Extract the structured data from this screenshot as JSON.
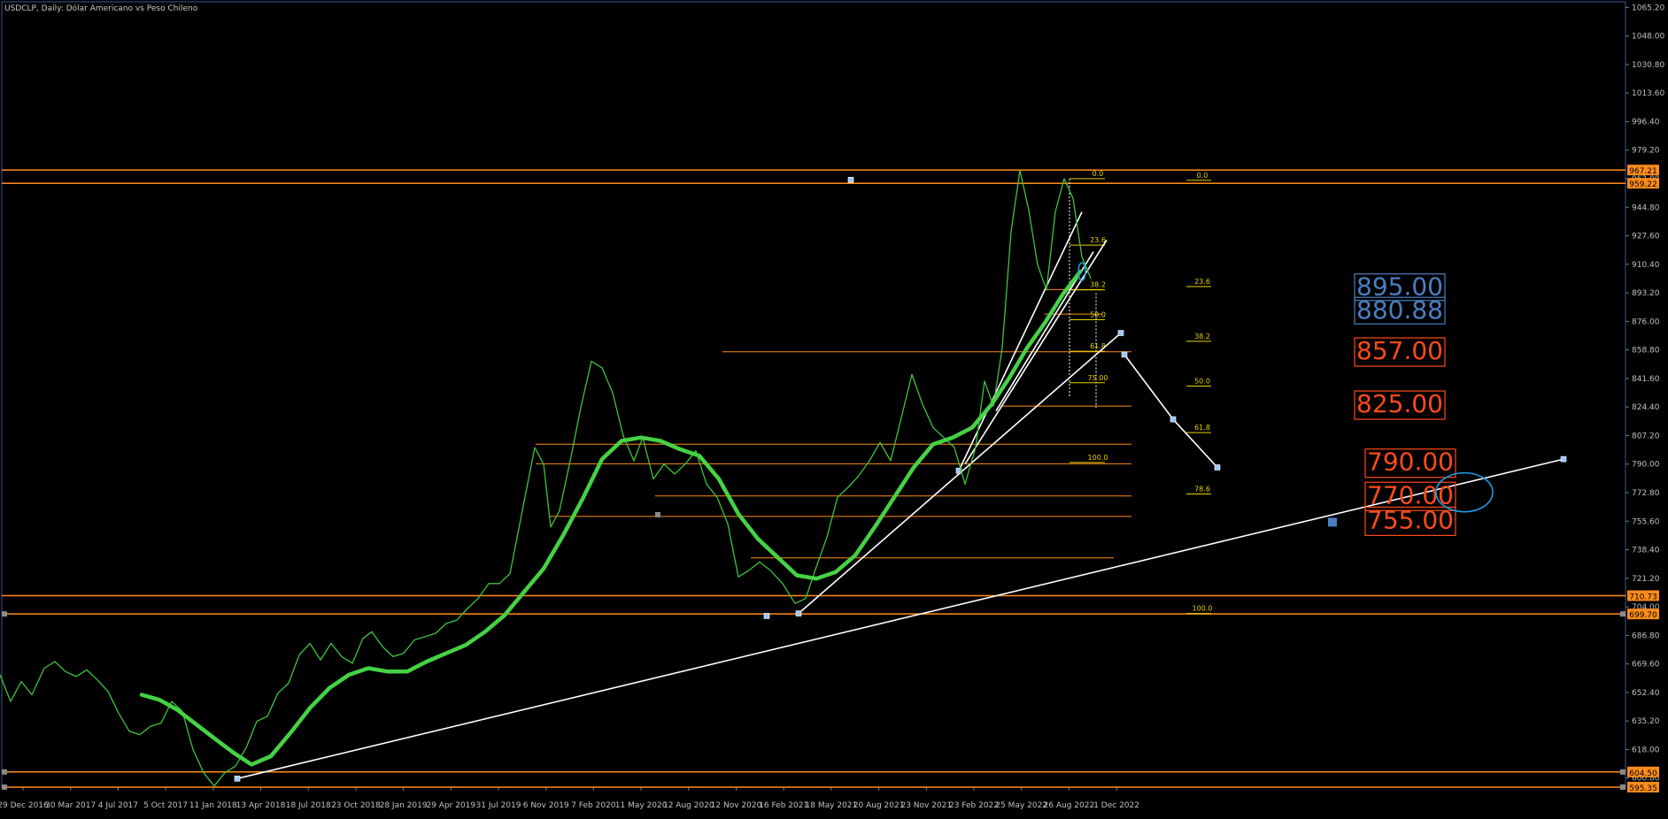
{
  "chart_data": {
    "type": "line",
    "title": "USDCLP, Daily:  Dólar Americano vs Peso Chileno",
    "y_axis_ticks": [
      "1065.20",
      "1048.00",
      "1030.80",
      "1013.60",
      "996.40",
      "979.20",
      "962.00",
      "944.80",
      "927.60",
      "910.40",
      "893.20",
      "876.00",
      "858.80",
      "841.60",
      "824.40",
      "807.20",
      "790.00",
      "772.80",
      "755.60",
      "738.40",
      "721.20",
      "704.00",
      "686.80",
      "669.60",
      "652.40",
      "635.20",
      "618.00",
      "600.80"
    ],
    "x_axis_ticks": [
      "29 Dec 2016",
      "30 Mar 2017",
      "4 Jul 2017",
      "5 Oct 2017",
      "11 Jan 2018",
      "13 Apr 2018",
      "18 Jul 2018",
      "23 Oct 2018",
      "28 Jan 2019",
      "29 Apr 2019",
      "31 Jul 2019",
      "6 Nov 2019",
      "7 Feb 2020",
      "11 May 2020",
      "12 Aug 2020",
      "12 Nov 2020",
      "16 Feb 2021",
      "18 May 2021",
      "20 Aug 2021",
      "23 Nov 2021",
      "23 Feb 2022",
      "25 May 2022",
      "26 Aug 2022",
      "1 Dec 2022"
    ],
    "ylim": [
      590,
      1067
    ],
    "series": [
      {
        "color": "#3cc43c",
        "values": [
          [
            0,
            663
          ],
          [
            12,
            647
          ],
          [
            24,
            659
          ],
          [
            36,
            651
          ],
          [
            50,
            667
          ],
          [
            62,
            671
          ],
          [
            74,
            665
          ],
          [
            86,
            662
          ],
          [
            98,
            666
          ],
          [
            110,
            660
          ],
          [
            122,
            653
          ],
          [
            134,
            640
          ],
          [
            146,
            629
          ],
          [
            158,
            627
          ],
          [
            170,
            632
          ],
          [
            182,
            634
          ],
          [
            194,
            647
          ],
          [
            206,
            641
          ],
          [
            218,
            618
          ],
          [
            230,
            604
          ],
          [
            242,
            596
          ],
          [
            254,
            604
          ],
          [
            266,
            608
          ],
          [
            278,
            619
          ],
          [
            290,
            635
          ],
          [
            302,
            638
          ],
          [
            314,
            652
          ],
          [
            326,
            658
          ],
          [
            338,
            675
          ],
          [
            350,
            682
          ],
          [
            362,
            672
          ],
          [
            374,
            682
          ],
          [
            386,
            674
          ],
          [
            398,
            670
          ],
          [
            410,
            685
          ],
          [
            420,
            689
          ],
          [
            432,
            680
          ],
          [
            444,
            674
          ],
          [
            456,
            676
          ],
          [
            468,
            684
          ],
          [
            480,
            686
          ],
          [
            492,
            688
          ],
          [
            504,
            694
          ],
          [
            516,
            696
          ],
          [
            528,
            703
          ],
          [
            540,
            709
          ],
          [
            552,
            718
          ],
          [
            564,
            718
          ],
          [
            576,
            724
          ],
          [
            590,
            762
          ],
          [
            604,
            800
          ],
          [
            614,
            790
          ],
          [
            622,
            752
          ],
          [
            632,
            762
          ],
          [
            644,
            792
          ],
          [
            656,
            824
          ],
          [
            668,
            852
          ],
          [
            680,
            848
          ],
          [
            692,
            833
          ],
          [
            704,
            807
          ],
          [
            716,
            792
          ],
          [
            726,
            806
          ],
          [
            738,
            781
          ],
          [
            750,
            790
          ],
          [
            762,
            784
          ],
          [
            774,
            790
          ],
          [
            786,
            798
          ],
          [
            798,
            778
          ],
          [
            810,
            770
          ],
          [
            822,
            754
          ],
          [
            834,
            722
          ],
          [
            846,
            726
          ],
          [
            858,
            731
          ],
          [
            870,
            726
          ],
          [
            884,
            718
          ],
          [
            898,
            706
          ],
          [
            910,
            709
          ],
          [
            922,
            728
          ],
          [
            934,
            746
          ],
          [
            946,
            770
          ],
          [
            958,
            776
          ],
          [
            970,
            783
          ],
          [
            982,
            792
          ],
          [
            994,
            803
          ],
          [
            1006,
            792
          ],
          [
            1018,
            818
          ],
          [
            1030,
            844
          ],
          [
            1042,
            826
          ],
          [
            1054,
            812
          ],
          [
            1066,
            806
          ],
          [
            1078,
            800
          ],
          [
            1090,
            778
          ],
          [
            1102,
            800
          ],
          [
            1112,
            840
          ],
          [
            1122,
            825
          ],
          [
            1132,
            860
          ],
          [
            1142,
            930
          ],
          [
            1152,
            967
          ],
          [
            1162,
            943
          ],
          [
            1172,
            910
          ],
          [
            1182,
            895
          ],
          [
            1192,
            942
          ],
          [
            1202,
            962
          ],
          [
            1212,
            950
          ],
          [
            1222,
            915
          ],
          [
            1232,
            902
          ]
        ]
      },
      {
        "color": "#45d245",
        "values": [
          [
            160,
            651
          ],
          [
            180,
            648
          ],
          [
            200,
            642
          ],
          [
            222,
            633
          ],
          [
            244,
            624
          ],
          [
            264,
            616
          ],
          [
            284,
            609
          ],
          [
            306,
            614
          ],
          [
            328,
            628
          ],
          [
            350,
            643
          ],
          [
            372,
            655
          ],
          [
            394,
            663
          ],
          [
            416,
            667
          ],
          [
            438,
            665
          ],
          [
            460,
            665
          ],
          [
            482,
            671
          ],
          [
            504,
            676
          ],
          [
            526,
            681
          ],
          [
            548,
            689
          ],
          [
            570,
            699
          ],
          [
            592,
            713
          ],
          [
            614,
            727
          ],
          [
            636,
            747
          ],
          [
            658,
            769
          ],
          [
            680,
            793
          ],
          [
            702,
            804
          ],
          [
            724,
            806
          ],
          [
            746,
            804
          ],
          [
            768,
            799
          ],
          [
            790,
            795
          ],
          [
            812,
            781
          ],
          [
            834,
            760
          ],
          [
            856,
            745
          ],
          [
            878,
            734
          ],
          [
            900,
            723
          ],
          [
            922,
            721
          ],
          [
            944,
            725
          ],
          [
            966,
            735
          ],
          [
            988,
            752
          ],
          [
            1010,
            770
          ],
          [
            1032,
            788
          ],
          [
            1054,
            802
          ],
          [
            1076,
            806
          ],
          [
            1098,
            812
          ],
          [
            1120,
            826
          ],
          [
            1140,
            842
          ],
          [
            1160,
            860
          ],
          [
            1180,
            875
          ],
          [
            1200,
            892
          ],
          [
            1220,
            906
          ]
        ]
      }
    ],
    "horizontal_levels": [
      "967.21",
      "959.22",
      "710.73",
      "699.70",
      "604.50",
      "595.35"
    ],
    "price_tags": [
      {
        "label": "967.21",
        "value": 967.21
      },
      {
        "label": "959.22",
        "value": 959.22
      },
      {
        "label": "710.73",
        "value": 710.73
      },
      {
        "label": "699.70",
        "value": 699.7
      },
      {
        "label": "604.50",
        "value": 604.5
      },
      {
        "label": "595.35",
        "value": 595.35
      }
    ],
    "support_levels": [
      "857.00",
      "825.00",
      "790.00",
      "770.00",
      "755.00"
    ],
    "resistance_levels_blue": [
      "895.00",
      "880.88"
    ],
    "fib_labels_left": [
      "0.0",
      "23.6",
      "38.2",
      "50.0",
      "61.8",
      "75.00",
      "100.0"
    ],
    "fib_labels_right": [
      "0.0",
      "23.6",
      "38.2",
      "50.0",
      "61.8",
      "78.6",
      "100.0"
    ],
    "grid": false,
    "legend": "none"
  },
  "colors": {
    "background": "#000000",
    "price_line": "#3cc43c",
    "moving_average": "#45d245",
    "levels": "#ff8c1a",
    "fib": "#e6d200",
    "trendline": "#ffffff",
    "blue_box": "#4a7fc0",
    "red_box": "#ff4a1a",
    "axis_text": "#c0c0c0",
    "circle": "#1e9be8"
  }
}
